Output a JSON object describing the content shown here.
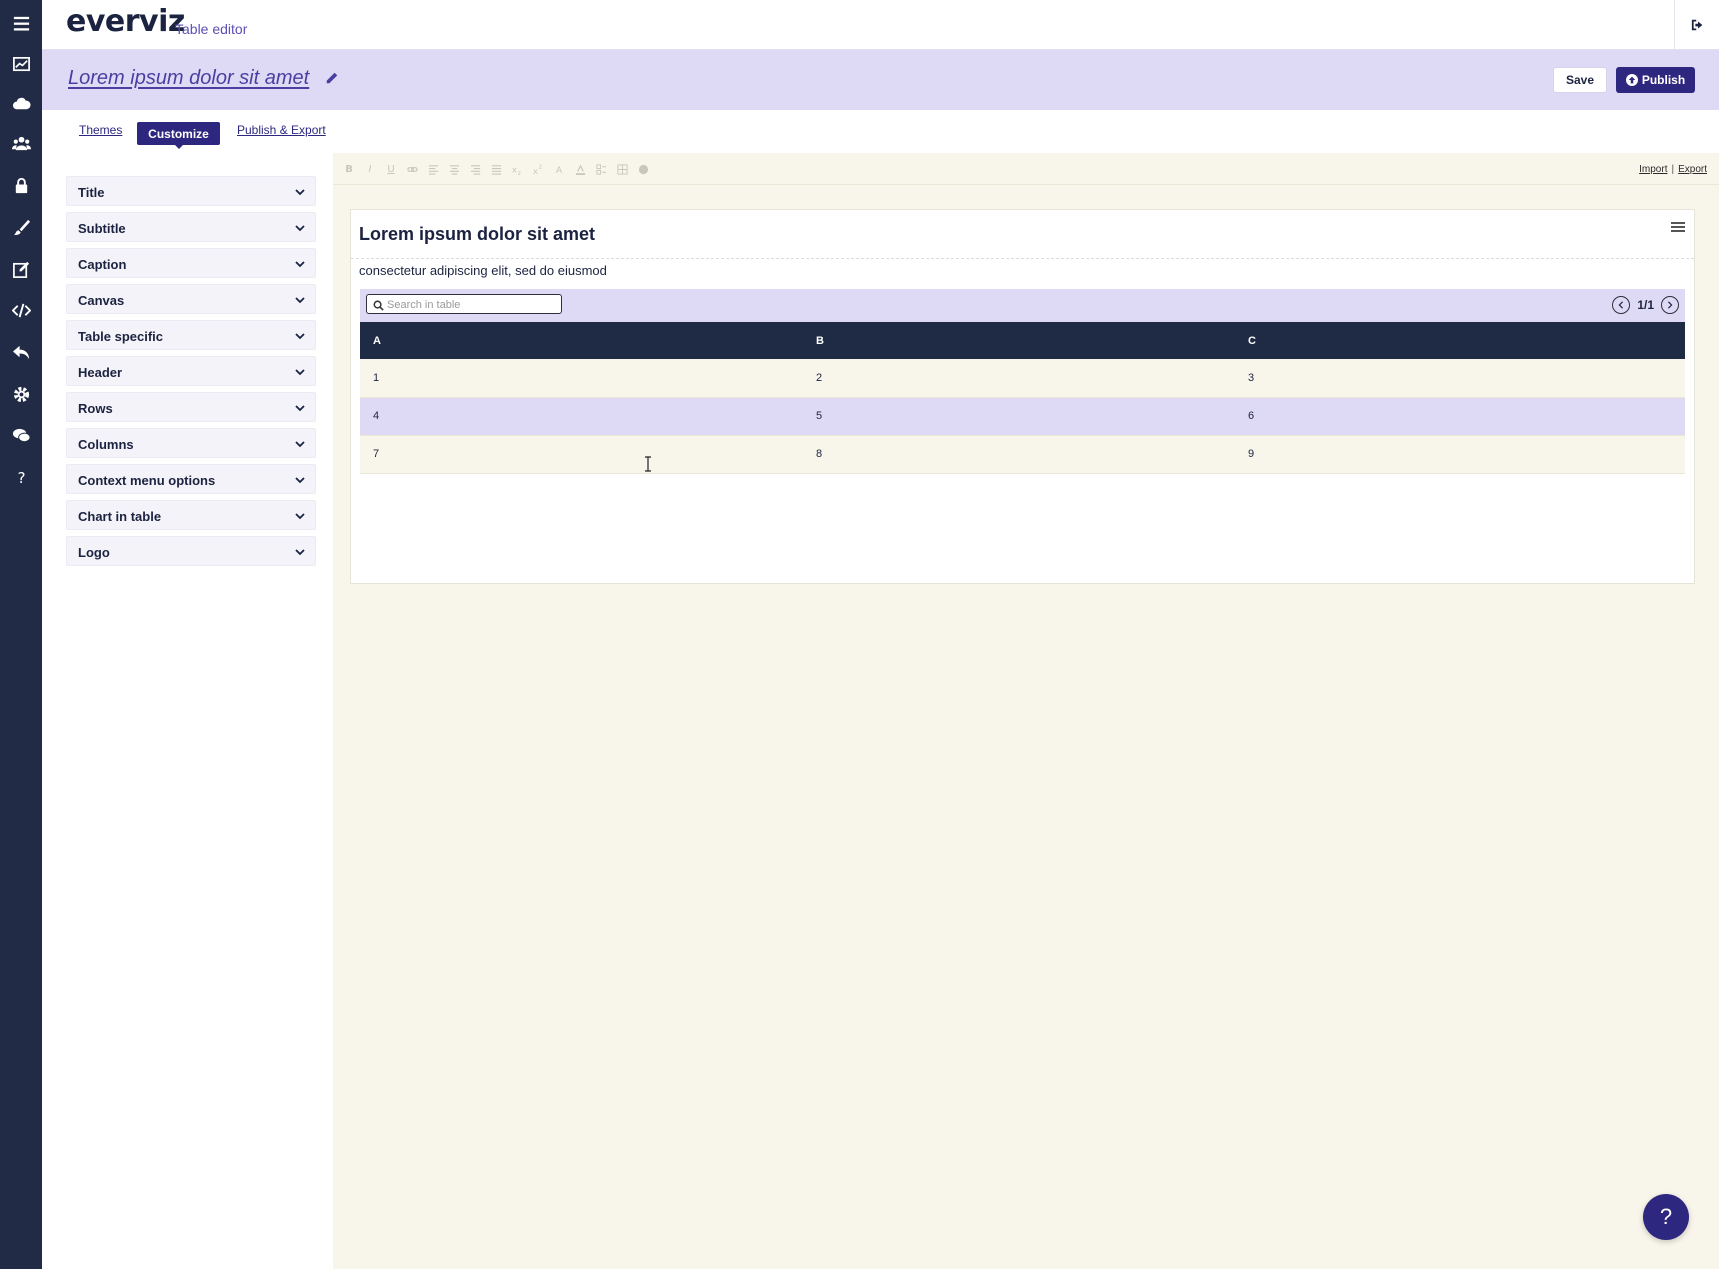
{
  "app": {
    "logo": "everviz",
    "subtitle": "Table editor"
  },
  "rail": {
    "items": [
      {
        "name": "menu-icon"
      },
      {
        "name": "charts-icon"
      },
      {
        "name": "cloud-icon"
      },
      {
        "name": "team-icon"
      },
      {
        "name": "lock-icon"
      },
      {
        "name": "brush-icon"
      },
      {
        "name": "edit-icon"
      },
      {
        "name": "code-icon"
      },
      {
        "name": "reply-icon"
      },
      {
        "name": "gear-icon"
      },
      {
        "name": "chat-icon"
      },
      {
        "name": "question-icon"
      }
    ]
  },
  "project": {
    "title": "Lorem ipsum dolor sit amet",
    "save_label": "Save",
    "publish_label": "Publish"
  },
  "tabs": {
    "themes": "Themes",
    "customize": "Customize",
    "publish_export": "Publish & Export"
  },
  "panel": {
    "sections": [
      "Title",
      "Subtitle",
      "Caption",
      "Canvas",
      "Table specific",
      "Header",
      "Rows",
      "Columns",
      "Context menu options",
      "Chart in table",
      "Logo"
    ]
  },
  "toolbar": {
    "buttons": [
      "B",
      "I",
      "U",
      "link",
      "align-left",
      "align-center",
      "align-right",
      "justify",
      "subscript",
      "superscript",
      "font-color",
      "highlight",
      "list",
      "table",
      "circle"
    ],
    "import_label": "Import",
    "separator": "|",
    "export_label": "Export"
  },
  "preview": {
    "title": "Lorem ipsum dolor sit amet",
    "subtitle": "consectetur adipiscing elit, sed do eiusmod",
    "search_placeholder": "Search in table",
    "page_label": "1/1",
    "columns": [
      "A",
      "B",
      "C"
    ],
    "rows": [
      [
        "1",
        "2",
        "3"
      ],
      [
        "4",
        "5",
        "6"
      ],
      [
        "7",
        "8",
        "9"
      ]
    ]
  },
  "help": {
    "label": "?"
  },
  "colors": {
    "rail": "#212b46",
    "accent": "#2e2780",
    "lavender": "#dedaf6",
    "cream": "#f8f5ea",
    "table_header": "#1f2b45"
  }
}
